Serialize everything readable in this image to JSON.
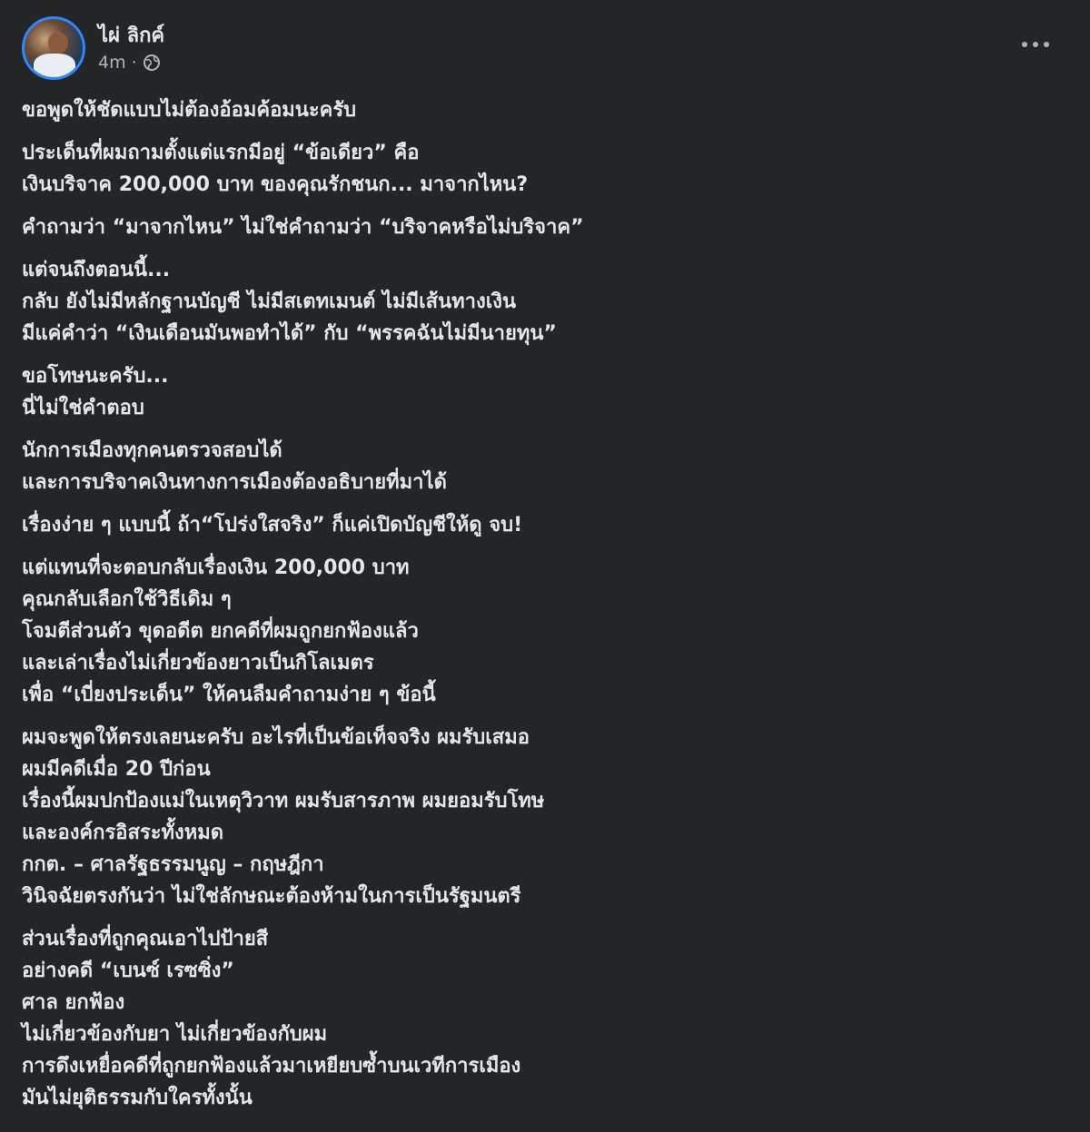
{
  "post": {
    "author": "ไผ่ ลิกค์",
    "time": "4m",
    "separator": "·",
    "icons": {
      "privacy": "globe-icon",
      "more": "more-horizontal-icon"
    },
    "paragraphs": [
      [
        "ขอพูดให้ชัดแบบไม่ต้องอ้อมค้อมนะครับ"
      ],
      [
        "ประเด็นที่ผมถามตั้งแต่แรกมีอยู่ “ข้อเดียว” คือ",
        "เงินบริจาค 200,000 บาท ของคุณรักชนก... มาจากไหน?"
      ],
      [
        "คำถามว่า “มาจากไหน” ไม่ใช่คำถามว่า “บริจาคหรือไม่บริจาค”"
      ],
      [
        "แต่จนถึงตอนนี้...",
        "กลับ ยังไม่มีหลักฐานบัญชี ไม่มีสเตทเมนต์ ไม่มีเส้นทางเงิน",
        "มีแค่คำว่า “เงินเดือนมันพอทำได้” กับ “พรรคฉันไม่มีนายทุน”"
      ],
      [
        "ขอโทษนะครับ...",
        "นี่ไม่ใช่คำตอบ"
      ],
      [
        "นักการเมืองทุกคนตรวจสอบได้",
        "และการบริจาคเงินทางการเมืองต้องอธิบายที่มาได้"
      ],
      [
        "เรื่องง่าย ๆ แบบนี้ ถ้า“โปร่งใสจริง” ก็แค่เปิดบัญชีให้ดู จบ!"
      ],
      [
        "แต่แทนที่จะตอบกลับเรื่องเงิน 200,000 บาท",
        "คุณกลับเลือกใช้วิธีเดิม ๆ",
        "โจมตีส่วนตัว ขุดอดีต ยกคดีที่ผมถูกยกฟ้องแล้ว",
        "และเล่าเรื่องไม่เกี่ยวข้องยาวเป็นกิโลเมตร",
        "เพื่อ “เบี่ยงประเด็น” ให้คนลืมคำถามง่าย ๆ ข้อนี้"
      ],
      [
        "ผมจะพูดให้ตรงเลยนะครับ อะไรที่เป็นข้อเท็จจริง ผมรับเสมอ",
        "ผมมีคดีเมื่อ 20 ปีก่อน",
        "เรื่องนี้ผมปกป้องแม่ในเหตุวิวาท ผมรับสารภาพ ผมยอมรับโทษ",
        "และองค์กรอิสระทั้งหมด",
        "กกต. – ศาลรัฐธรรมนูญ – กฤษฎีกา",
        "วินิจฉัยตรงกันว่า ไม่ใช่ลักษณะต้องห้ามในการเป็นรัฐมนตรี"
      ],
      [
        "ส่วนเรื่องที่ถูกคุณเอาไปป้ายสี",
        "อย่างคดี “เบนซ์ เรซซิ่ง”",
        "ศาล ยกฟ้อง",
        "ไม่เกี่ยวข้องกับยา ไม่เกี่ยวข้องกับผม",
        "การดึงเหยื่อคดีที่ถูกยกฟ้องแล้วมาเหยียบซ้ำบนเวทีการเมือง",
        "มันไม่ยุติธรรมกับใครทั้งนั้น"
      ]
    ]
  }
}
